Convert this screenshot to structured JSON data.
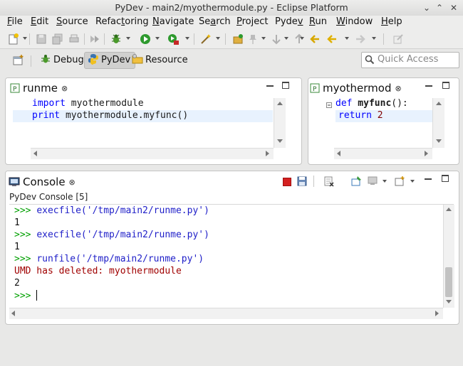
{
  "window": {
    "title": "PyDev - main2/myothermodule.py - Eclipse Platform"
  },
  "menubar": {
    "items": [
      {
        "u": "F",
        "rest": "ile"
      },
      {
        "u": "E",
        "rest": "dit"
      },
      {
        "u": "S",
        "rest": "ource"
      },
      {
        "pre": "Refac",
        "u": "t",
        "rest": "oring"
      },
      {
        "u": "N",
        "rest": "avigate"
      },
      {
        "pre": "Se",
        "u": "a",
        "rest": "rch"
      },
      {
        "u": "P",
        "rest": "roject"
      },
      {
        "pre": "Pyde",
        "u": "v",
        "rest": ""
      },
      {
        "u": "R",
        "rest": "un"
      },
      {
        "u": "W",
        "rest": "indow"
      },
      {
        "u": "H",
        "rest": "elp"
      }
    ]
  },
  "perspectives": {
    "debug": "Debug",
    "pydev": "PyDev",
    "resource": "Resource"
  },
  "quick_access": {
    "placeholder": "Quick Access"
  },
  "editor_left": {
    "tab_label": "runme",
    "lines": [
      {
        "kw": "import",
        "rest": " myothermodule"
      },
      {
        "kw": "print",
        "rest": " myothermodule.myfunc()"
      }
    ]
  },
  "editor_right": {
    "tab_label": "myothermod",
    "lines": [
      {
        "kw": "def",
        "fname": " myfunc",
        "rest": "():"
      },
      {
        "kw": "return",
        "rest": " 2"
      }
    ]
  },
  "console": {
    "tab_label": "Console",
    "subtitle": "PyDev Console [5]",
    "lines": [
      {
        "type": "cmd",
        "prompt": ">>> ",
        "text": "execfile('/tmp/main2/runme.py')"
      },
      {
        "type": "out",
        "prompt": "",
        "text": "1"
      },
      {
        "type": "cmd",
        "prompt": ">>> ",
        "text": "execfile('/tmp/main2/runme.py')"
      },
      {
        "type": "out",
        "prompt": "",
        "text": "1"
      },
      {
        "type": "cmd",
        "prompt": ">>> ",
        "text": "runfile('/tmp/main2/runme.py')"
      },
      {
        "type": "err",
        "prompt": "",
        "text": "UMD has deleted: myothermodule"
      },
      {
        "type": "out",
        "prompt": "",
        "text": "2"
      },
      {
        "type": "cmd",
        "prompt": ">>> ",
        "text": ""
      }
    ]
  },
  "colors": {
    "keyword": "#0000ff",
    "prompt": "#00a000",
    "command": "#1e1ec8",
    "error": "#a00000",
    "current_line": "#e8f2fe"
  }
}
